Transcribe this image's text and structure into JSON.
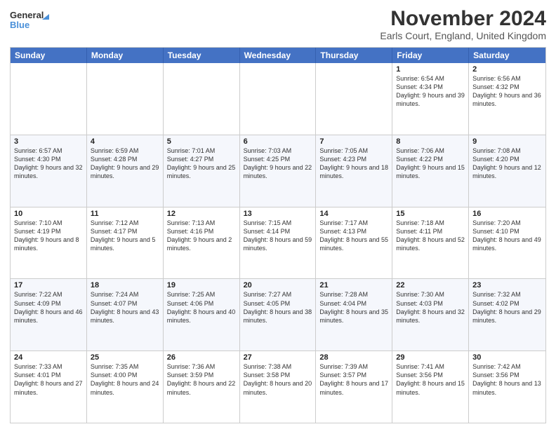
{
  "header": {
    "logo_general": "General",
    "logo_blue": "Blue",
    "main_title": "November 2024",
    "subtitle": "Earls Court, England, United Kingdom"
  },
  "days_of_week": [
    "Sunday",
    "Monday",
    "Tuesday",
    "Wednesday",
    "Thursday",
    "Friday",
    "Saturday"
  ],
  "weeks": [
    [
      {
        "day": "",
        "info": ""
      },
      {
        "day": "",
        "info": ""
      },
      {
        "day": "",
        "info": ""
      },
      {
        "day": "",
        "info": ""
      },
      {
        "day": "",
        "info": ""
      },
      {
        "day": "1",
        "info": "Sunrise: 6:54 AM\nSunset: 4:34 PM\nDaylight: 9 hours and 39 minutes."
      },
      {
        "day": "2",
        "info": "Sunrise: 6:56 AM\nSunset: 4:32 PM\nDaylight: 9 hours and 36 minutes."
      }
    ],
    [
      {
        "day": "3",
        "info": "Sunrise: 6:57 AM\nSunset: 4:30 PM\nDaylight: 9 hours and 32 minutes."
      },
      {
        "day": "4",
        "info": "Sunrise: 6:59 AM\nSunset: 4:28 PM\nDaylight: 9 hours and 29 minutes."
      },
      {
        "day": "5",
        "info": "Sunrise: 7:01 AM\nSunset: 4:27 PM\nDaylight: 9 hours and 25 minutes."
      },
      {
        "day": "6",
        "info": "Sunrise: 7:03 AM\nSunset: 4:25 PM\nDaylight: 9 hours and 22 minutes."
      },
      {
        "day": "7",
        "info": "Sunrise: 7:05 AM\nSunset: 4:23 PM\nDaylight: 9 hours and 18 minutes."
      },
      {
        "day": "8",
        "info": "Sunrise: 7:06 AM\nSunset: 4:22 PM\nDaylight: 9 hours and 15 minutes."
      },
      {
        "day": "9",
        "info": "Sunrise: 7:08 AM\nSunset: 4:20 PM\nDaylight: 9 hours and 12 minutes."
      }
    ],
    [
      {
        "day": "10",
        "info": "Sunrise: 7:10 AM\nSunset: 4:19 PM\nDaylight: 9 hours and 8 minutes."
      },
      {
        "day": "11",
        "info": "Sunrise: 7:12 AM\nSunset: 4:17 PM\nDaylight: 9 hours and 5 minutes."
      },
      {
        "day": "12",
        "info": "Sunrise: 7:13 AM\nSunset: 4:16 PM\nDaylight: 9 hours and 2 minutes."
      },
      {
        "day": "13",
        "info": "Sunrise: 7:15 AM\nSunset: 4:14 PM\nDaylight: 8 hours and 59 minutes."
      },
      {
        "day": "14",
        "info": "Sunrise: 7:17 AM\nSunset: 4:13 PM\nDaylight: 8 hours and 55 minutes."
      },
      {
        "day": "15",
        "info": "Sunrise: 7:18 AM\nSunset: 4:11 PM\nDaylight: 8 hours and 52 minutes."
      },
      {
        "day": "16",
        "info": "Sunrise: 7:20 AM\nSunset: 4:10 PM\nDaylight: 8 hours and 49 minutes."
      }
    ],
    [
      {
        "day": "17",
        "info": "Sunrise: 7:22 AM\nSunset: 4:09 PM\nDaylight: 8 hours and 46 minutes."
      },
      {
        "day": "18",
        "info": "Sunrise: 7:24 AM\nSunset: 4:07 PM\nDaylight: 8 hours and 43 minutes."
      },
      {
        "day": "19",
        "info": "Sunrise: 7:25 AM\nSunset: 4:06 PM\nDaylight: 8 hours and 40 minutes."
      },
      {
        "day": "20",
        "info": "Sunrise: 7:27 AM\nSunset: 4:05 PM\nDaylight: 8 hours and 38 minutes."
      },
      {
        "day": "21",
        "info": "Sunrise: 7:28 AM\nSunset: 4:04 PM\nDaylight: 8 hours and 35 minutes."
      },
      {
        "day": "22",
        "info": "Sunrise: 7:30 AM\nSunset: 4:03 PM\nDaylight: 8 hours and 32 minutes."
      },
      {
        "day": "23",
        "info": "Sunrise: 7:32 AM\nSunset: 4:02 PM\nDaylight: 8 hours and 29 minutes."
      }
    ],
    [
      {
        "day": "24",
        "info": "Sunrise: 7:33 AM\nSunset: 4:01 PM\nDaylight: 8 hours and 27 minutes."
      },
      {
        "day": "25",
        "info": "Sunrise: 7:35 AM\nSunset: 4:00 PM\nDaylight: 8 hours and 24 minutes."
      },
      {
        "day": "26",
        "info": "Sunrise: 7:36 AM\nSunset: 3:59 PM\nDaylight: 8 hours and 22 minutes."
      },
      {
        "day": "27",
        "info": "Sunrise: 7:38 AM\nSunset: 3:58 PM\nDaylight: 8 hours and 20 minutes."
      },
      {
        "day": "28",
        "info": "Sunrise: 7:39 AM\nSunset: 3:57 PM\nDaylight: 8 hours and 17 minutes."
      },
      {
        "day": "29",
        "info": "Sunrise: 7:41 AM\nSunset: 3:56 PM\nDaylight: 8 hours and 15 minutes."
      },
      {
        "day": "30",
        "info": "Sunrise: 7:42 AM\nSunset: 3:56 PM\nDaylight: 8 hours and 13 minutes."
      }
    ]
  ]
}
